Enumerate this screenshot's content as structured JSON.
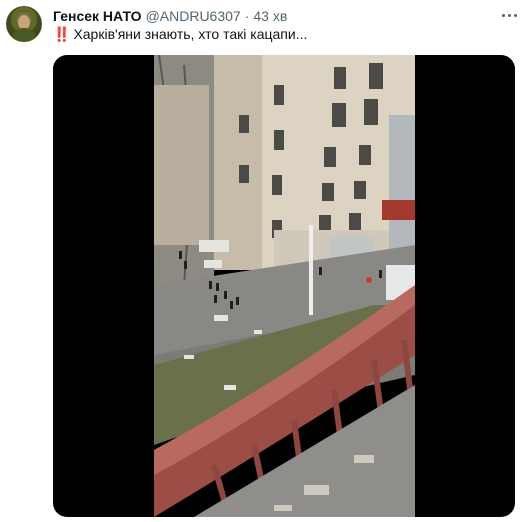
{
  "tweet": {
    "author_name": "Генсек НАТО",
    "handle": "@ANDRU6307",
    "separator": "·",
    "time": "43 хв",
    "text_emoji": "‼️",
    "text": "Харків'яни знають, хто такі кацапи...",
    "avatar_icon": "avatar-icon",
    "more_icon": "more-icon"
  },
  "media": {
    "type": "video",
    "content": "street scene with damaged apartment building viewed from a balcony"
  }
}
